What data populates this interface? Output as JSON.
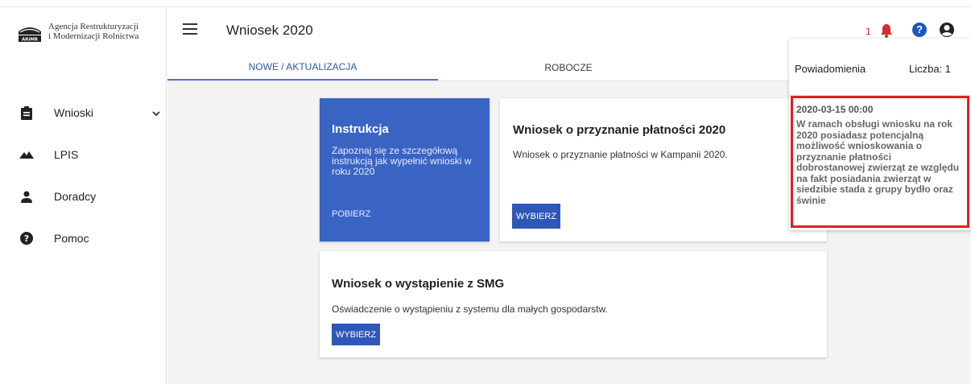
{
  "brand": {
    "line1": "Agencja Restrukturyzacji",
    "line2": "i Modernizacji Rolnictwa",
    "logo_text": "ARiMR"
  },
  "sidebar": {
    "items": [
      {
        "label": "Wnioski",
        "icon": "clipboard-icon",
        "expandable": true
      },
      {
        "label": "LPIS",
        "icon": "mountains-icon"
      },
      {
        "label": "Doradcy",
        "icon": "person-icon"
      },
      {
        "label": "Pomoc",
        "icon": "help-circle-icon"
      }
    ]
  },
  "header": {
    "title": "Wniosek 2020",
    "notification_count": "1",
    "icons": [
      "menu-icon",
      "bell-icon",
      "help-icon",
      "account-icon"
    ]
  },
  "tabs": [
    {
      "label": "NOWE / AKTUALIZACJA",
      "active": true
    },
    {
      "label": "ROBOCZE",
      "active": false
    }
  ],
  "cards": {
    "instruction": {
      "title": "Instrukcja",
      "text": "Zapoznaj się ze szczegółową instrukcją jak wypełnić wnioski w roku 2020",
      "link": "POBIERZ"
    },
    "payment": {
      "title": "Wniosek o przyznanie płatności 2020",
      "text": "Wniosek o przyznanie płatności w Kampanii 2020.",
      "button": "WYBIERZ"
    },
    "smg": {
      "title": "Wniosek o wystąpienie z SMG",
      "text": "Oświadczenie o wystąpieniu z systemu dla małych gospodarstw.",
      "button": "WYBIERZ"
    }
  },
  "notifications": {
    "title": "Powiadomienia",
    "count_label": "Liczba: 1",
    "items": [
      {
        "date": "2020-03-15 00:00",
        "message": "W ramach obsługi wniosku na rok 2020 posiadasz potencjalną możliwość wnioskowania o przyznanie płatności dobrostanowej zwierząt ze względu na fakt posiadania zwierząt w siedzibie stada z grupy bydło oraz świnie"
      }
    ]
  },
  "colors": {
    "accent": "#2f57b8",
    "instruction_card": "#3a64c4",
    "highlight_border": "#e41e1e",
    "bell": "#d32f2f"
  }
}
